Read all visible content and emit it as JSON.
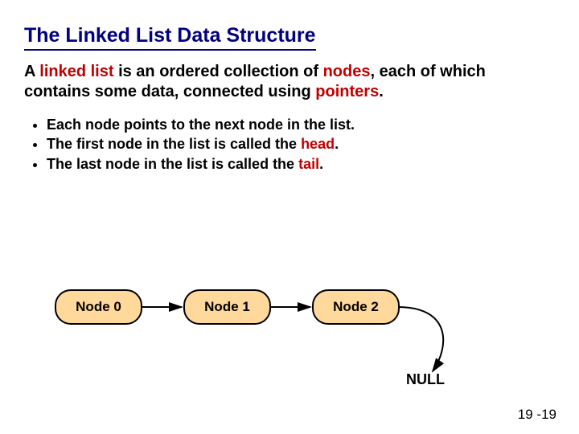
{
  "title": "The Linked List Data Structure",
  "para": {
    "t1": "A ",
    "k1": "linked list",
    "t2": " is an ordered collection of ",
    "k2": "nodes",
    "t3": ", each of which contains some data, connected using ",
    "k3": "pointers",
    "t4": "."
  },
  "bullets": [
    {
      "pre": "Each node points to the next node in the list.",
      "kw": "",
      "post": ""
    },
    {
      "pre": "The first node in the list is called the ",
      "kw": "head",
      "post": "."
    },
    {
      "pre": "The last node in the list is called the ",
      "kw": "tail",
      "post": "."
    }
  ],
  "nodes": [
    "Node 0",
    "Node 1",
    "Node 2"
  ],
  "null_label": "NULL",
  "page_number": "19 -19"
}
